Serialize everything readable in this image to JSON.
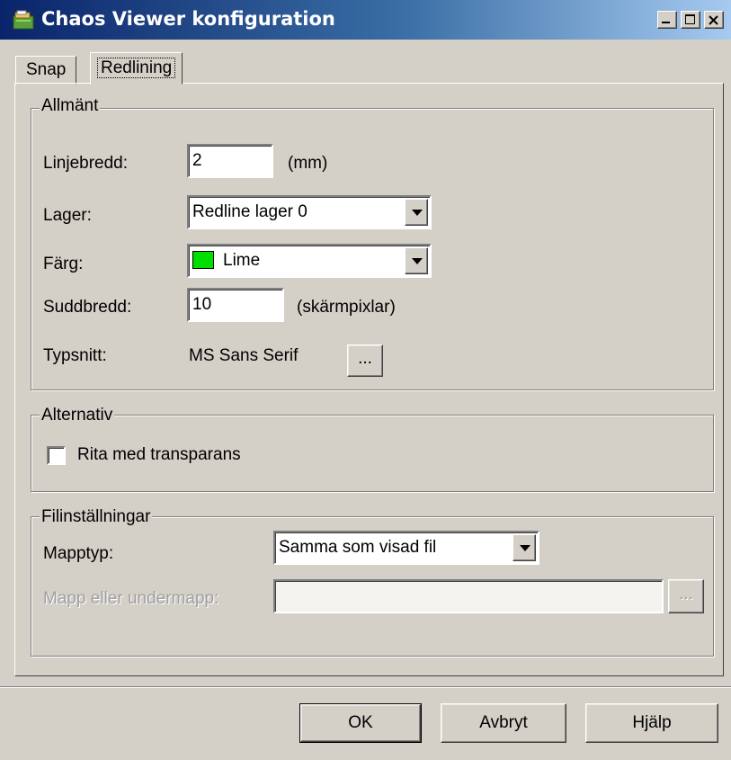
{
  "window": {
    "title": "Chaos Viewer konfiguration",
    "title_icon": "app-icon",
    "controls": [
      "minimize-icon",
      "maximize-icon",
      "close-icon"
    ]
  },
  "tabs": [
    {
      "label": "Snap",
      "active": false
    },
    {
      "label": "Redlining",
      "active": true
    }
  ],
  "general": {
    "title": "Allmänt",
    "line_width_label": "Linjebredd:",
    "line_width_value": "2",
    "line_width_unit": "(mm)",
    "layer_label": "Lager:",
    "layer_value": "Redline lager 0",
    "color_label": "Färg:",
    "color_value": "Lime",
    "color_hex": "#00e000",
    "eraser_label": "Suddbredd:",
    "eraser_value": "10",
    "eraser_unit": "(skärmpixlar)",
    "font_label": "Typsnitt:",
    "font_value": "MS Sans Serif",
    "font_button": "..."
  },
  "options": {
    "title": "Alternativ",
    "transparency_label": "Rita med transparans",
    "transparency_checked": false
  },
  "file_settings": {
    "title": "Filinställningar",
    "folder_type_label": "Mapptyp:",
    "folder_type_value": "Samma som visad fil",
    "folder_label": "Mapp eller undermapp:",
    "folder_value": "",
    "browse_button": "..."
  },
  "buttons": {
    "ok": "OK",
    "cancel": "Avbryt",
    "help": "Hjälp"
  }
}
